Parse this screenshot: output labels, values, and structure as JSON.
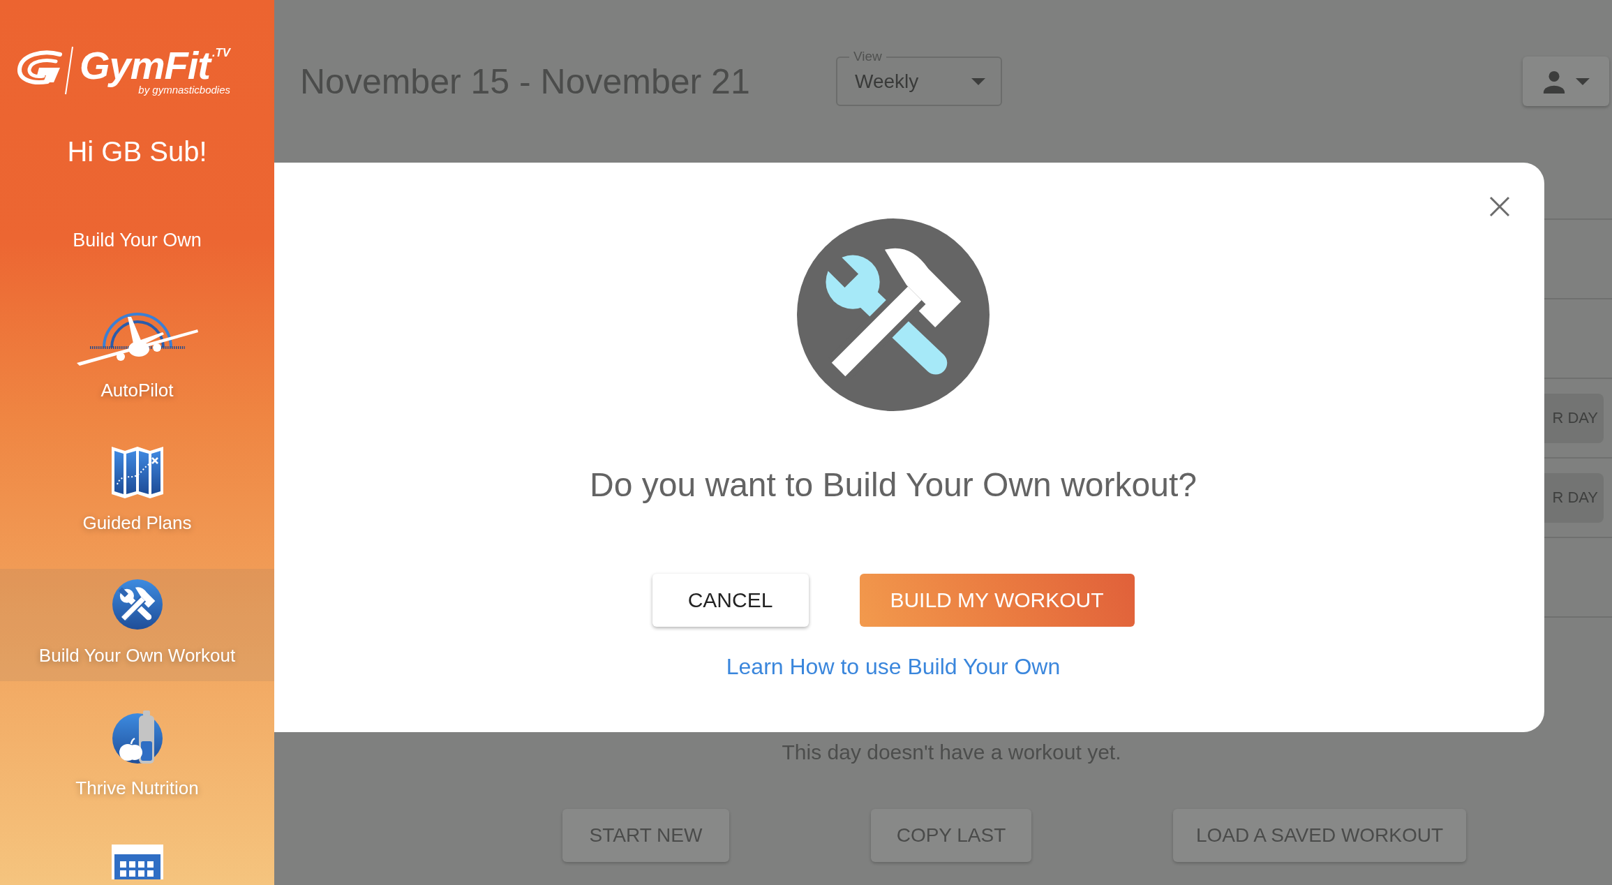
{
  "sidebar": {
    "logo": {
      "wordmark": "GymFit$^{.TV}$",
      "tagline": "by gymnasticbodies"
    },
    "greeting": "Hi GB Sub!",
    "section_title": "Build Your Own",
    "items": [
      {
        "label": "AutoPilot",
        "selected": false
      },
      {
        "label": "Guided Plans",
        "selected": false
      },
      {
        "label": "Build Your Own Workout",
        "selected": true
      },
      {
        "label": "Thrive Nutrition",
        "selected": false
      },
      {
        "selected": false
      }
    ]
  },
  "header": {
    "title": "November 15 - November 21",
    "view_select": {
      "label": "View",
      "value": "Weekly"
    }
  },
  "week_rows": {
    "cut_off_buttons": [
      "R DAY",
      "R DAY"
    ]
  },
  "empty_day": {
    "message": "This day doesn't have a workout yet.",
    "buttons": [
      "START NEW",
      "COPY LAST",
      "LOAD A SAVED WORKOUT"
    ]
  },
  "modal": {
    "question": "Do you want to Build Your Own workout?",
    "buttons": [
      {
        "label": "CANCEL",
        "kind": "secondary"
      },
      {
        "label": "BUILD MY WORKOUT",
        "kind": "primary"
      }
    ],
    "link": "Learn How to use Build Your Own"
  }
}
